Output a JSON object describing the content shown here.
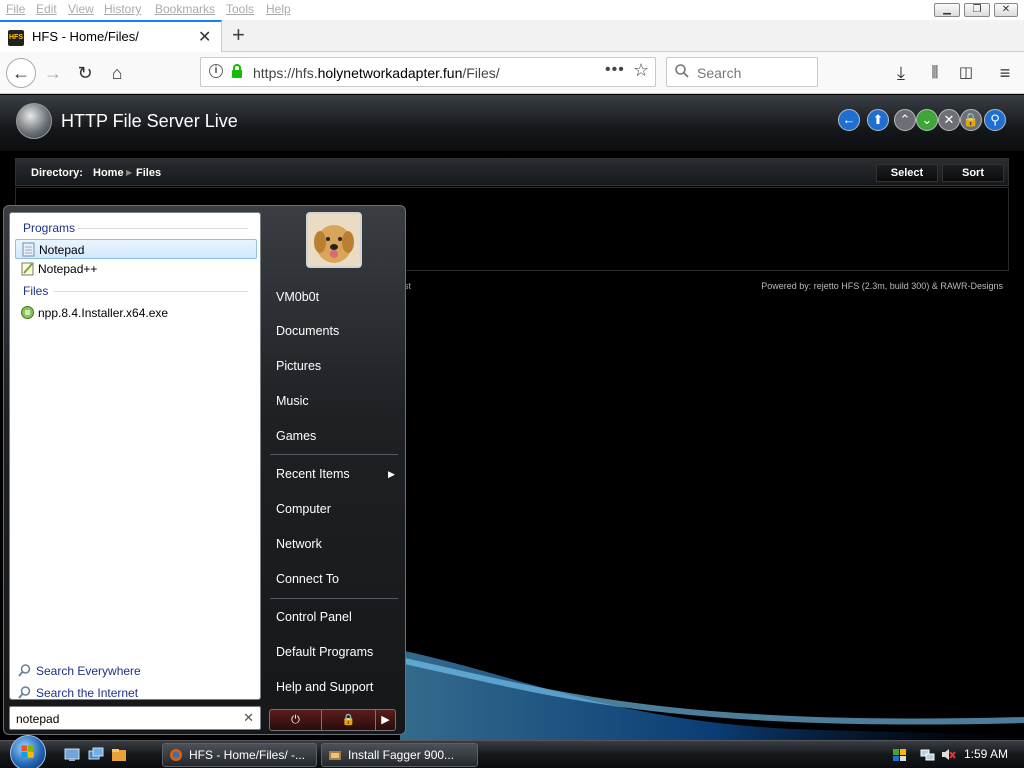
{
  "browser": {
    "menu": [
      "File",
      "Edit",
      "View",
      "History",
      "Bookmarks",
      "Tools",
      "Help"
    ],
    "tab_title": "HFS - Home/Files/",
    "url_prefix": "https://hfs.",
    "url_host": "holynetworkadapter.fun",
    "url_path": "/Files/",
    "search_placeholder": "Search"
  },
  "hfs": {
    "title": "HTTP File Server Live",
    "directory_label": "Directory:",
    "breadcrumbs": [
      "Home",
      "Files"
    ],
    "select_label": "Select",
    "sort_label": "Sort",
    "powered_by": "Powered by: rejetto HFS (2.3m, build 300) & RAWR-Designs",
    "ghost_text": "st"
  },
  "start_menu": {
    "programs_header": "Programs",
    "programs": [
      {
        "label": "Notepad",
        "icon": "notepad-icon",
        "selected": true
      },
      {
        "label": "Notepad++",
        "icon": "notepadpp-icon",
        "selected": false
      }
    ],
    "files_header": "Files",
    "files": [
      {
        "label": "npp.8.4.Installer.x64.exe",
        "icon": "installer-icon"
      }
    ],
    "search_everywhere": "Search Everywhere",
    "search_internet": "Search the Internet",
    "search_value": "notepad",
    "user": "VM0b0t",
    "right_items": [
      "Documents",
      "Pictures",
      "Music",
      "Games",
      "Recent Items",
      "Computer",
      "Network",
      "Connect To",
      "Control Panel",
      "Default Programs",
      "Help and Support"
    ]
  },
  "taskbar": {
    "buttons": [
      "HFS - Home/Files/ -...",
      "Install Fagger 900..."
    ],
    "clock": "1:59 AM"
  }
}
